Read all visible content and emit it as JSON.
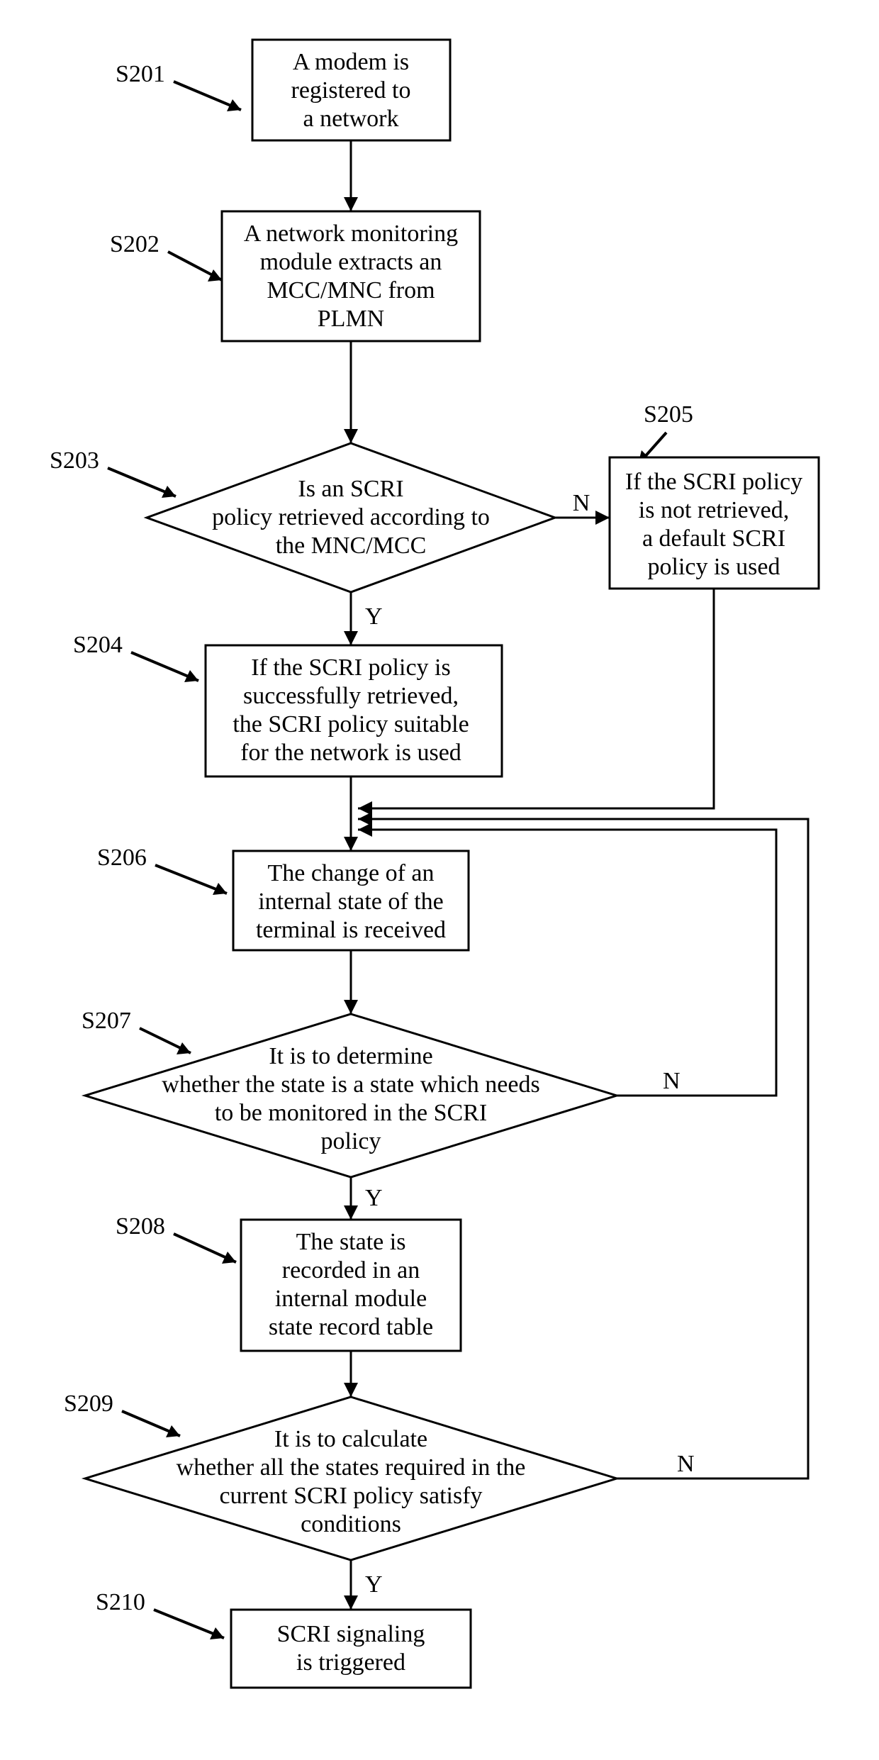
{
  "labels": {
    "s201": "S201",
    "s202": "S202",
    "s203": "S203",
    "s204": "S204",
    "s205": "S205",
    "s206": "S206",
    "s207": "S207",
    "s208": "S208",
    "s209": "S209",
    "s210": "S210"
  },
  "nodes": {
    "n201_l1": "A modem is",
    "n201_l2": "registered to",
    "n201_l3": "a network",
    "n202_l1": "A network monitoring",
    "n202_l2": "module extracts an",
    "n202_l3": "MCC/MNC from",
    "n202_l4": "PLMN",
    "n203_l1": "Is an SCRI",
    "n203_l2": "policy retrieved according to",
    "n203_l3": "the MNC/MCC",
    "n204_l1": "If the SCRI policy is",
    "n204_l2": "successfully retrieved,",
    "n204_l3": "the SCRI policy suitable",
    "n204_l4": "for the network is used",
    "n205_l1": "If the SCRI policy",
    "n205_l2": "is not retrieved,",
    "n205_l3": "a default SCRI",
    "n205_l4": "policy is used",
    "n206_l1": "The change of an",
    "n206_l2": "internal state of the",
    "n206_l3": "terminal is received",
    "n207_l1": "It is to determine",
    "n207_l2": "whether the state is a state which needs",
    "n207_l3": "to be monitored in the SCRI",
    "n207_l4": "policy",
    "n208_l1": "The state is",
    "n208_l2": "recorded in an",
    "n208_l3": "internal module",
    "n208_l4": "state record table",
    "n209_l1": "It is to calculate",
    "n209_l2": "whether all the states required in the",
    "n209_l3": "current SCRI policy satisfy",
    "n209_l4": "conditions",
    "n210_l1": "SCRI signaling",
    "n210_l2": "is triggered"
  },
  "branches": {
    "yes": "Y",
    "no": "N"
  }
}
